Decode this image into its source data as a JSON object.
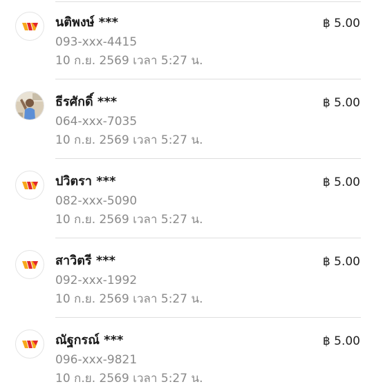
{
  "transactions": [
    {
      "name": "นติพงษ์ ***",
      "phone": "093-xxx-4415",
      "datetime": "10 ก.ย. 2569 เวลา 5:27 น.",
      "amount": "฿ 5.00",
      "avatar": "truemoney-logo-icon"
    },
    {
      "name": "ธีรศักดิ์ ***",
      "phone": "064-xxx-7035",
      "datetime": "10 ก.ย. 2569 เวลา 5:27 น.",
      "amount": "฿ 5.00",
      "avatar": "profile-photo"
    },
    {
      "name": "ปวิตรา ***",
      "phone": "082-xxx-5090",
      "datetime": "10 ก.ย. 2569 เวลา 5:27 น.",
      "amount": "฿ 5.00",
      "avatar": "truemoney-logo-icon"
    },
    {
      "name": "สาวิตรี ***",
      "phone": "092-xxx-1992",
      "datetime": "10 ก.ย. 2569 เวลา 5:27 น.",
      "amount": "฿ 5.00",
      "avatar": "truemoney-logo-icon"
    },
    {
      "name": "ณัฐกรณ์ ***",
      "phone": "096-xxx-9821",
      "datetime": "10 ก.ย. 2569 เวลา 5:27 น.",
      "amount": "฿ 5.00",
      "avatar": "truemoney-logo-icon"
    }
  ],
  "colors": {
    "logo_orange": "#f7a81b",
    "logo_red": "#e3262b",
    "muted_text": "#8a8a8a",
    "divider": "#dedede"
  }
}
